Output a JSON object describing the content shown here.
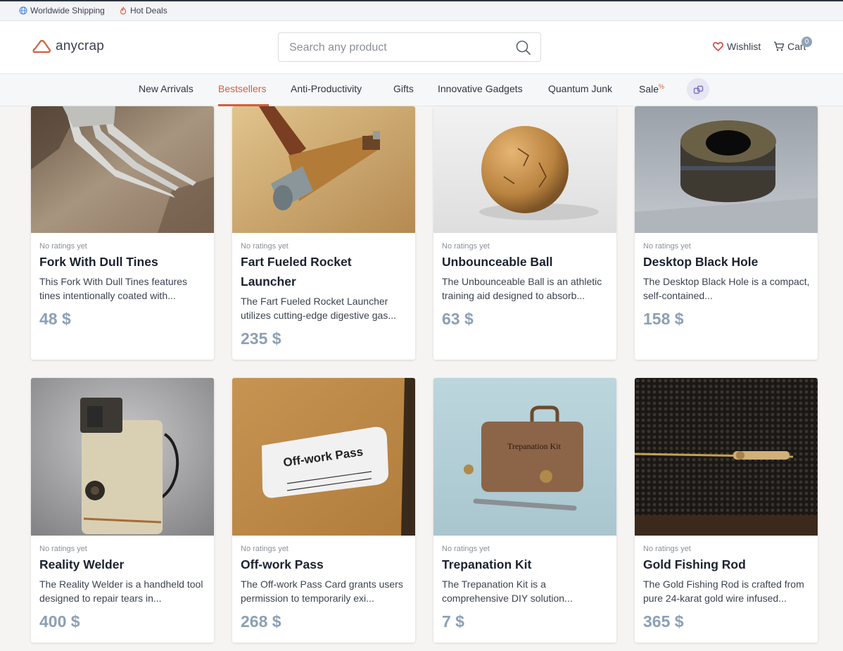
{
  "topbar": {
    "shipping": "Worldwide Shipping",
    "deals": "Hot Deals"
  },
  "header": {
    "logo_text": "anycrap",
    "search_placeholder": "Search any product",
    "wishlist_label": "Wishlist",
    "cart_label": "Cart",
    "cart_count": "0"
  },
  "nav": {
    "items": [
      "New Arrivals",
      "Bestsellers",
      "Anti-Productivity",
      "Gifts",
      "Innovative Gadgets",
      "Quantum Junk",
      "Sale"
    ],
    "sale_badge": "%",
    "active": "Bestsellers"
  },
  "products": [
    {
      "rating": "No ratings yet",
      "name": "Fork With Dull Tines",
      "desc": "This Fork With Dull Tines features tines intentionally coated with...",
      "price": "48 $"
    },
    {
      "rating": "No ratings yet",
      "name": "Fart Fueled Rocket Launcher",
      "desc": "The Fart Fueled Rocket Launcher utilizes cutting-edge digestive gas...",
      "price": "235 $"
    },
    {
      "rating": "No ratings yet",
      "name": "Unbounceable Ball",
      "desc": "The Unbounceable Ball is an athletic training aid designed to absorb...",
      "price": "63 $"
    },
    {
      "rating": "No ratings yet",
      "name": "Desktop Black Hole",
      "desc": "The Desktop Black Hole is a compact, self-contained...",
      "price": "158 $"
    },
    {
      "rating": "No ratings yet",
      "name": "Reality Welder",
      "desc": "The Reality Welder is a handheld tool designed to repair tears in...",
      "price": "400 $"
    },
    {
      "rating": "No ratings yet",
      "name": "Off-work Pass",
      "desc": "The Off-work Pass Card grants users permission to temporarily exi...",
      "price": "268 $",
      "image_text": "Off-work Pass"
    },
    {
      "rating": "No ratings yet",
      "name": "Trepanation Kit",
      "desc": "The Trepanation Kit is a comprehensive DIY solution...",
      "price": "7 $",
      "image_text": "Trepanation Kit"
    },
    {
      "rating": "No ratings yet",
      "name": "Gold Fishing Rod",
      "desc": "The Gold Fishing Rod is crafted from pure 24-karat gold wire infused...",
      "price": "365 $"
    }
  ],
  "colors": {
    "accent": "#d35e3f",
    "price": "#8ca0b5",
    "dark": "#1b2230"
  }
}
